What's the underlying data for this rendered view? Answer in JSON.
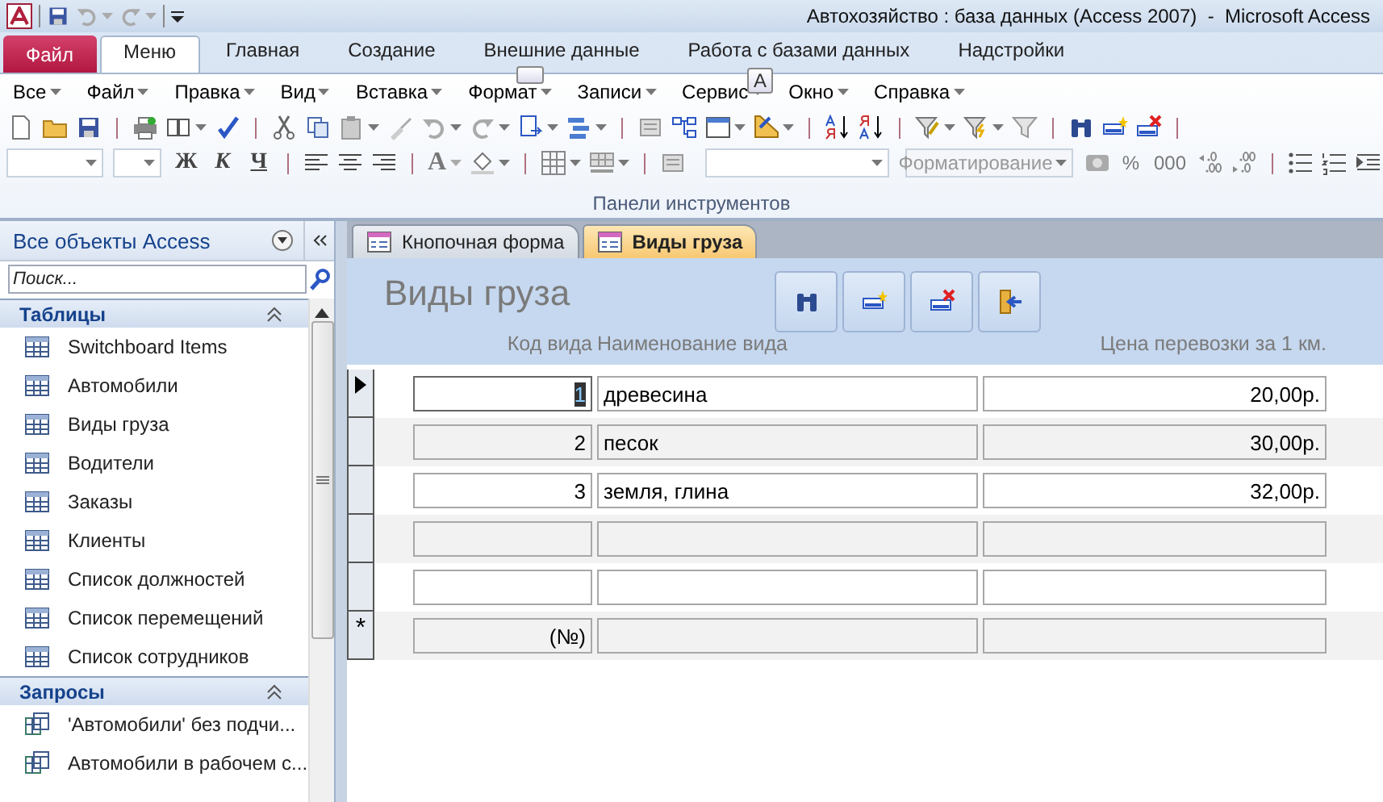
{
  "window": {
    "title": "Автохозяйство : база данных (Access 2007)  -  Microsoft Access"
  },
  "ribbon_tabs": [
    {
      "label": "Файл",
      "kind": "file",
      "selected": false
    },
    {
      "label": "Меню",
      "kind": "tab",
      "selected": true
    },
    {
      "label": "Главная",
      "kind": "tab",
      "selected": false
    },
    {
      "label": "Создание",
      "kind": "tab",
      "selected": false
    },
    {
      "label": "Внешние данные",
      "kind": "tab",
      "selected": false
    },
    {
      "label": "Работа с базами данных",
      "kind": "tab",
      "selected": false
    },
    {
      "label": "Надстройки",
      "kind": "tab",
      "selected": false
    }
  ],
  "keytip": "A",
  "menu": [
    "Все",
    "Файл",
    "Правка",
    "Вид",
    "Вставка",
    "Формат",
    "Записи",
    "Сервис",
    "Окно",
    "Справка"
  ],
  "format_buttons": [
    "Ж",
    "К",
    "Ч"
  ],
  "font_color_button": "A",
  "format_combo": {
    "value": "Форматирование",
    "disabled": true
  },
  "number_buttons": [
    "%",
    "000"
  ],
  "group_label": "Панели инструментов",
  "nav": {
    "title": "Все объекты Access",
    "search": {
      "placeholder": "Поиск..."
    },
    "groups": [
      {
        "label": "Таблицы",
        "kind": "table",
        "expanded": true,
        "items": [
          "Switchboard Items",
          "Автомобили",
          "Виды груза",
          "Водители",
          "Заказы",
          "Клиенты",
          "Список должностей",
          "Список перемещений",
          "Список сотрудников"
        ]
      },
      {
        "label": "Запросы",
        "kind": "query",
        "expanded": true,
        "items": [
          "'Автомобили' без подчи...",
          "Автомобили в рабочем с..."
        ]
      }
    ]
  },
  "doc_tabs": [
    {
      "label": "Кнопочная форма",
      "selected": false
    },
    {
      "label": "Виды груза",
      "selected": true
    }
  ],
  "form": {
    "title": "Виды груза",
    "columns": [
      "Код вида",
      "Наименование вида",
      "Цена перевозки за 1 км."
    ],
    "rows": [
      {
        "kind": "current",
        "focused": true,
        "cells": [
          "1",
          "древесина",
          "20,00р."
        ]
      },
      {
        "kind": "record",
        "focused": false,
        "cells": [
          "2",
          "песок",
          "30,00р."
        ]
      },
      {
        "kind": "record",
        "focused": false,
        "cells": [
          "3",
          "земля, глина",
          "32,00р."
        ]
      },
      {
        "kind": "record",
        "focused": false
      },
      {
        "kind": "record",
        "focused": false
      },
      {
        "kind": "new",
        "marker": "*",
        "focused": false,
        "cells": [
          "(№)"
        ]
      }
    ]
  }
}
